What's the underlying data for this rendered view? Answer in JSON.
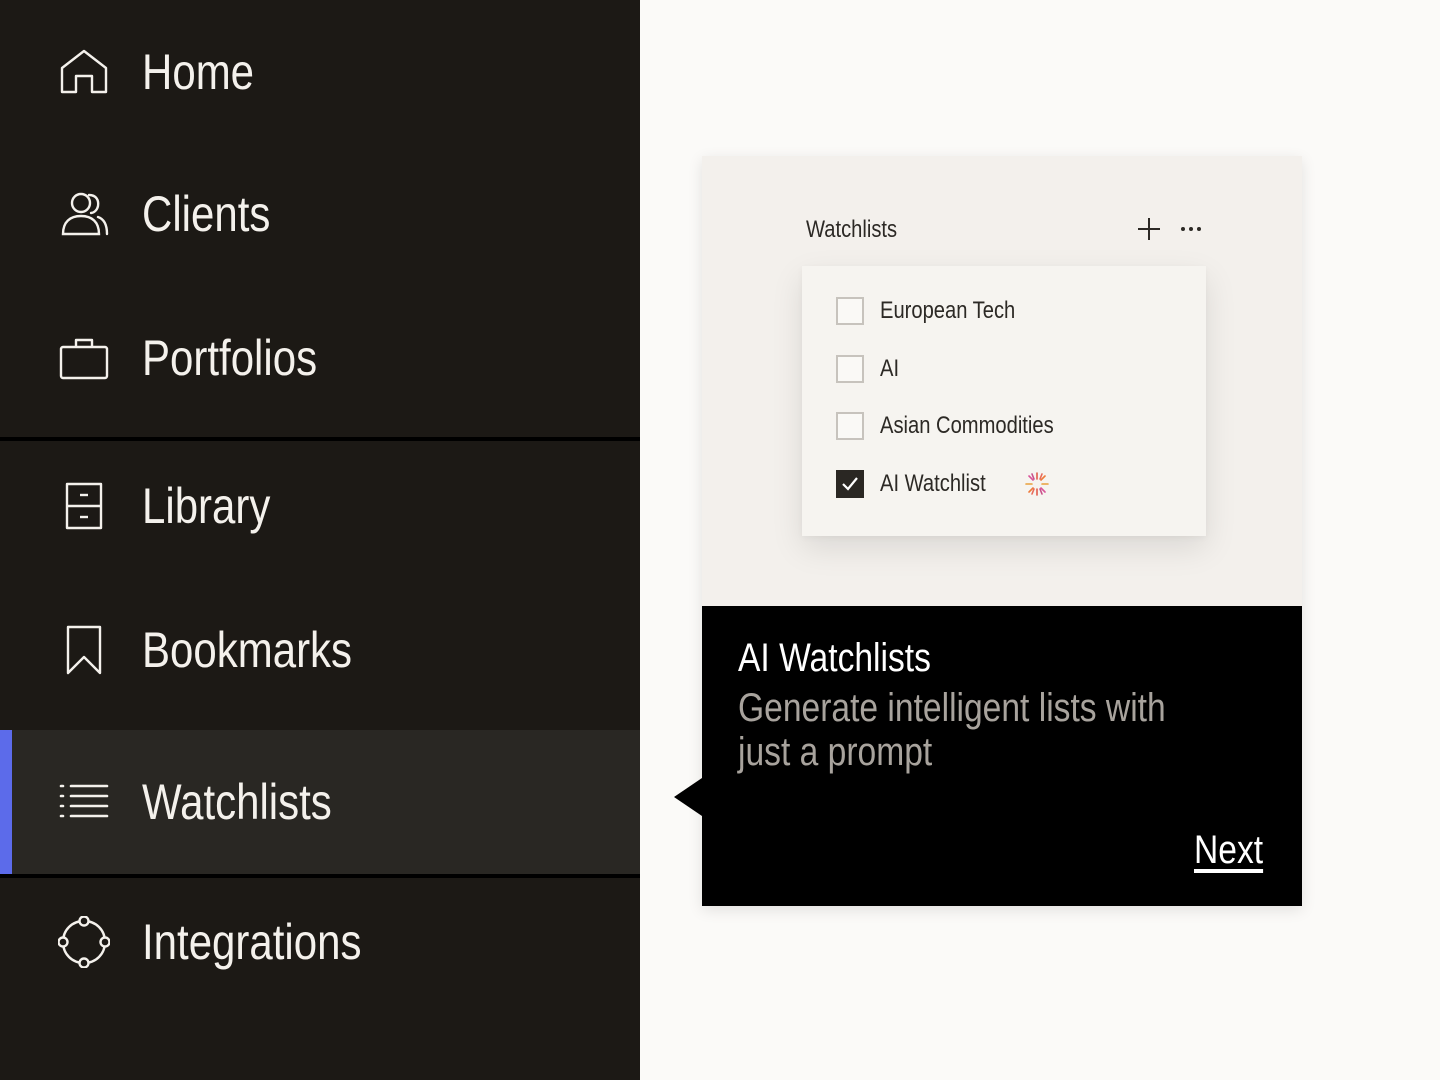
{
  "sidebar": {
    "items": [
      {
        "label": "Home",
        "icon": "home-icon"
      },
      {
        "label": "Clients",
        "icon": "users-icon"
      },
      {
        "label": "Portfolios",
        "icon": "briefcase-icon"
      },
      {
        "label": "Library",
        "icon": "cabinet-icon"
      },
      {
        "label": "Bookmarks",
        "icon": "bookmark-icon"
      },
      {
        "label": "Watchlists",
        "icon": "list-icon",
        "active": true
      },
      {
        "label": "Integrations",
        "icon": "integrations-icon"
      }
    ],
    "active_color": "#5c6bea"
  },
  "preview": {
    "title": "Watchlists",
    "actions": [
      "plus-icon",
      "more-icon"
    ],
    "options": [
      {
        "label": "European Tech",
        "checked": false
      },
      {
        "label": "AI",
        "checked": false
      },
      {
        "label": "Asian Commodities",
        "checked": false
      },
      {
        "label": "AI Watchlist",
        "checked": true,
        "badge": "sparkle-icon"
      }
    ]
  },
  "tooltip": {
    "title": "AI Watchlists",
    "description": "Generate intelligent lists with just a prompt",
    "next_label": "Next"
  }
}
